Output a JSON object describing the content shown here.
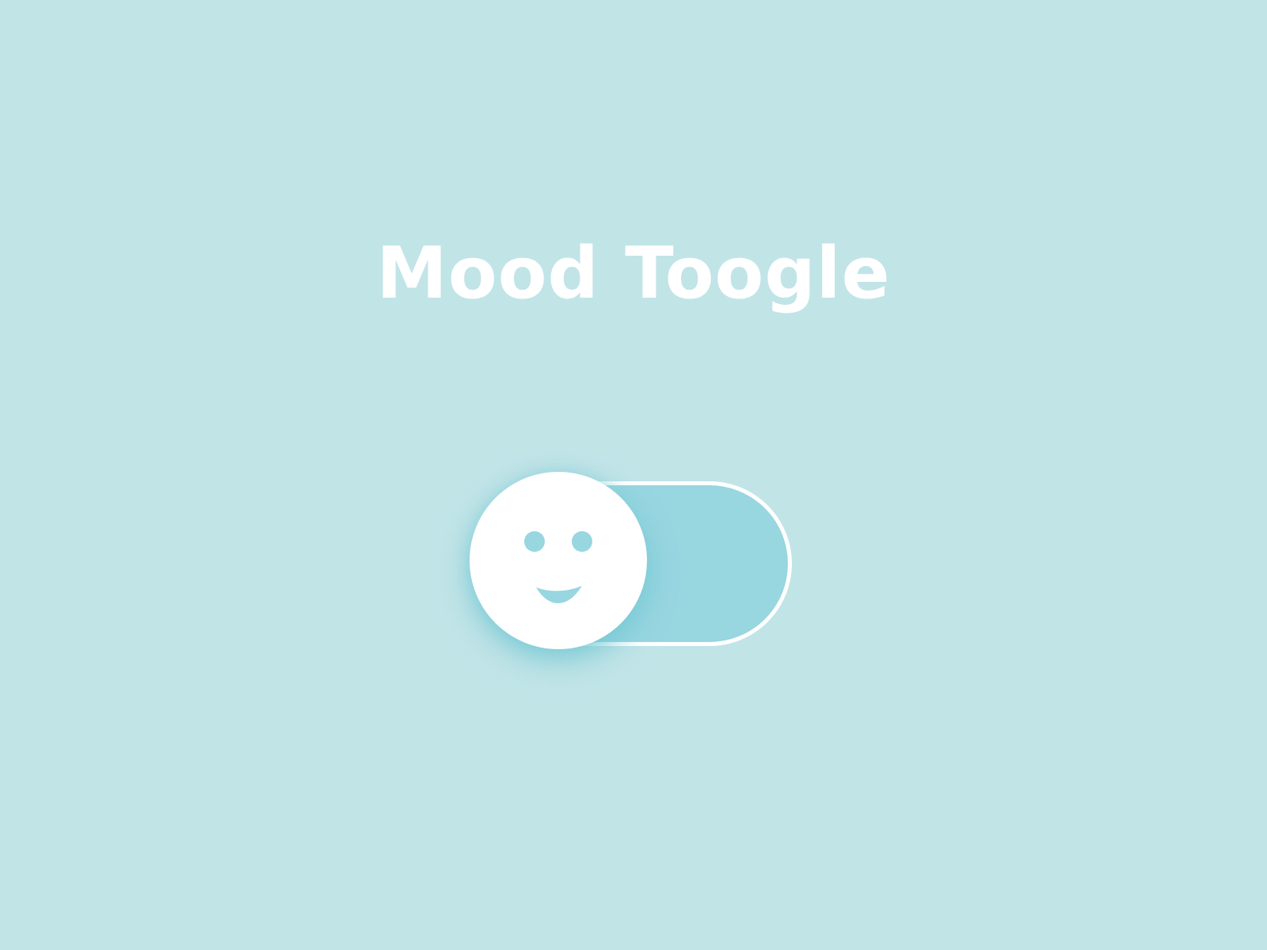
{
  "header": {
    "title": "Mood Toogle"
  },
  "toggle": {
    "state": "on",
    "mood_icon": "smiley-face-icon"
  },
  "colors": {
    "background": "#c1e4e7",
    "track_fill": "#98d6e0",
    "knob": "#ffffff",
    "face_features": "#98d6e0",
    "title_text": "#ffffff"
  }
}
